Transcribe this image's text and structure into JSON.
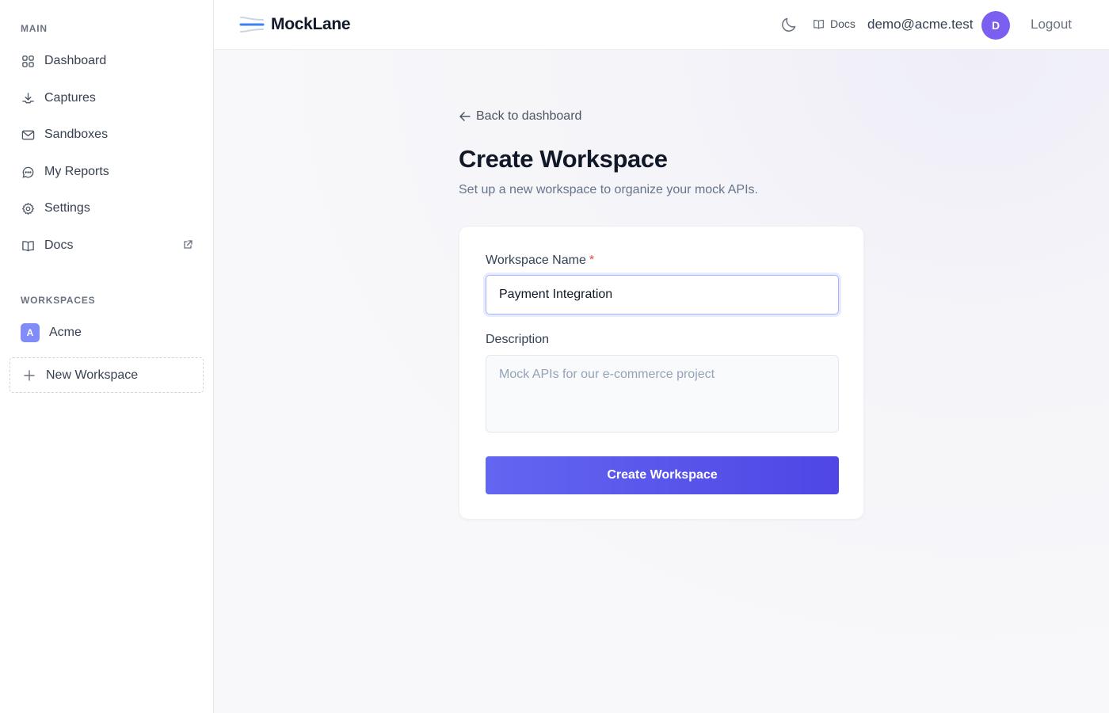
{
  "brand": {
    "name": "MockLane"
  },
  "sidebar": {
    "main_label": "MAIN",
    "items": [
      {
        "label": "Dashboard",
        "icon": "grid-icon"
      },
      {
        "label": "Captures",
        "icon": "download-icon"
      },
      {
        "label": "Sandboxes",
        "icon": "mail-icon"
      },
      {
        "label": "My Reports",
        "icon": "chat-icon"
      },
      {
        "label": "Settings",
        "icon": "gear-icon"
      },
      {
        "label": "Docs",
        "icon": "book-icon",
        "external": true
      }
    ],
    "workspaces_label": "WORKSPACES",
    "workspaces": [
      {
        "initial": "A",
        "name": "Acme"
      }
    ],
    "new_workspace_label": "New Workspace"
  },
  "topbar": {
    "docs_label": "Docs",
    "email": "demo@acme.test",
    "avatar_initial": "D",
    "logout_label": "Logout"
  },
  "main": {
    "back_label": "Back to dashboard",
    "title": "Create Workspace",
    "subtitle": "Set up a new workspace to organize your mock APIs.",
    "form": {
      "name_label": "Workspace Name",
      "required_mark": "*",
      "name_value": "Payment Integration",
      "description_label": "Description",
      "description_placeholder": "Mock APIs for our e-commerce project",
      "submit_label": "Create Workspace"
    }
  },
  "colors": {
    "accent": "#4f46e5",
    "accent_light": "#6366f1",
    "avatar": "#7c5ff0",
    "workspace_avatar": "#818cf8",
    "required": "#ef4444"
  }
}
